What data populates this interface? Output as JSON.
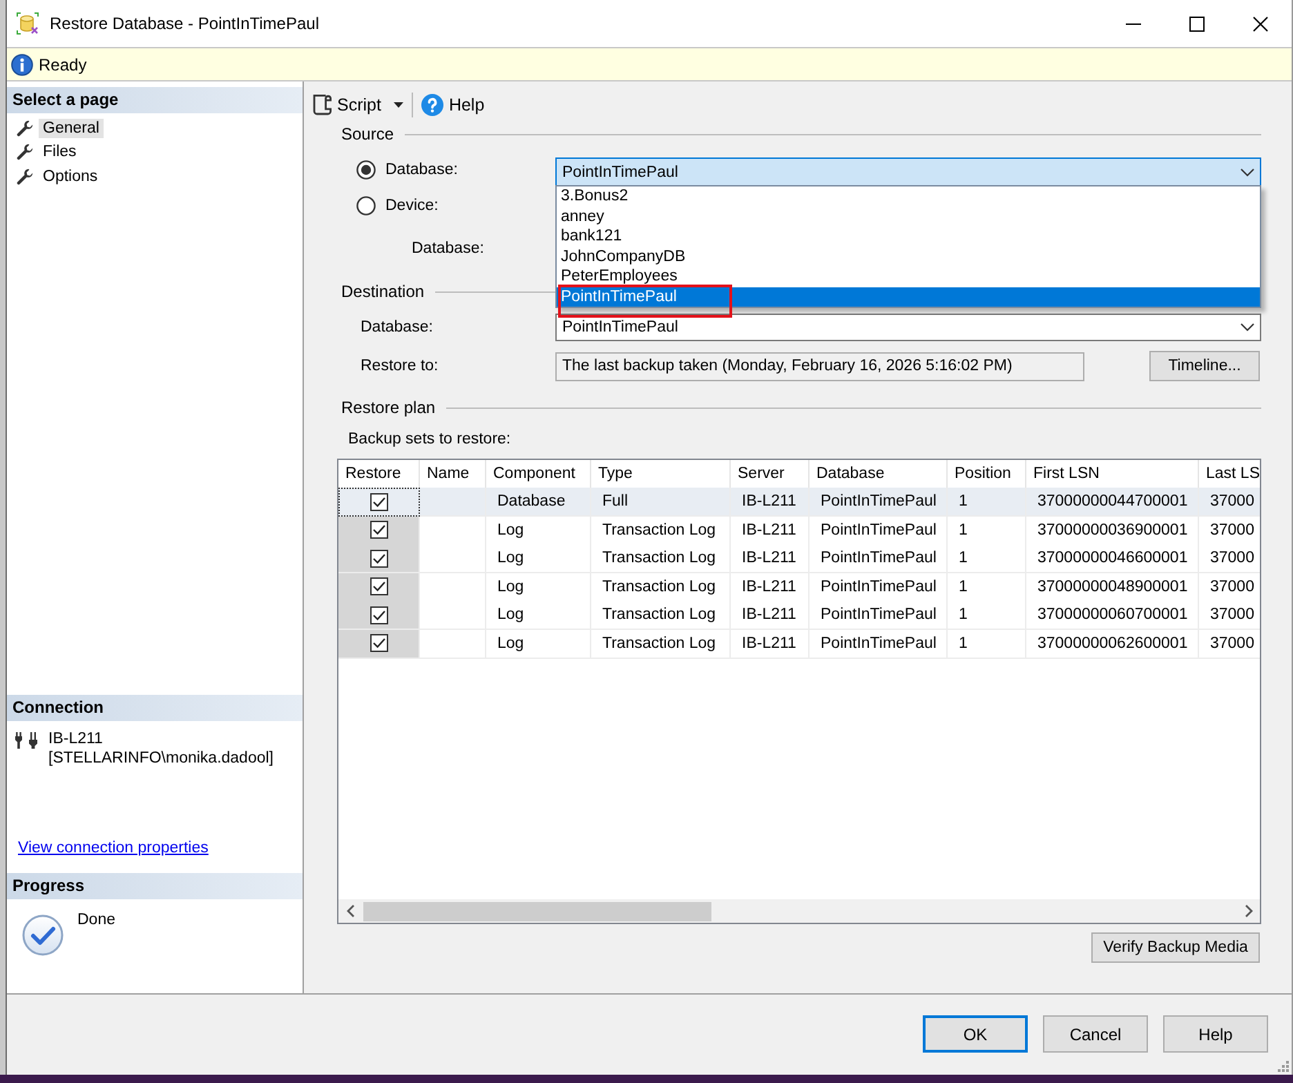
{
  "window": {
    "title": "Restore Database - PointInTimePaul"
  },
  "info_bar": {
    "text": "Ready"
  },
  "sidebar": {
    "title": "Select a page",
    "pages": [
      {
        "label": "General",
        "selected": true
      },
      {
        "label": "Files",
        "selected": false
      },
      {
        "label": "Options",
        "selected": false
      }
    ],
    "connection": {
      "title": "Connection",
      "server": "IB-L211",
      "user": "[STELLARINFO\\monika.dadool]",
      "link": "View connection properties"
    },
    "progress": {
      "title": "Progress",
      "status": "Done"
    }
  },
  "toolbar": {
    "script": "Script",
    "help": "Help"
  },
  "source": {
    "title": "Source",
    "options": [
      {
        "label": "Database:",
        "selected": true
      },
      {
        "label": "Device:",
        "selected": false
      }
    ],
    "database_combo": {
      "value": "PointInTimePaul",
      "expanded": true,
      "items": [
        {
          "label": "3.Bonus2",
          "selected": false,
          "outlined": false
        },
        {
          "label": "anney",
          "selected": false,
          "outlined": false
        },
        {
          "label": "bank121",
          "selected": false,
          "outlined": false
        },
        {
          "label": "JohnCompanyDB",
          "selected": false,
          "outlined": false
        },
        {
          "label": "PeterEmployees",
          "selected": false,
          "outlined": false
        },
        {
          "label": "PointInTimePaul",
          "selected": true,
          "outlined": true
        }
      ]
    },
    "database_label": "Database:"
  },
  "destination": {
    "title": "Destination",
    "database_label": "Database:",
    "database_combo": {
      "value": "PointInTimePaul",
      "expanded": false
    },
    "restore_to_label": "Restore to:",
    "restore_to_value": "The last backup taken (Monday, February 16, 2026 5:16:02 PM)",
    "timeline_button": "Timeline..."
  },
  "restore_plan": {
    "title": "Restore plan",
    "table_label": "Backup sets to restore:",
    "columns": [
      "Restore",
      "Name",
      "Component",
      "Type",
      "Server",
      "Database",
      "Position",
      "First LSN",
      "Last LS"
    ],
    "rows": [
      {
        "selected": true,
        "checked": true,
        "cells": [
          "",
          "",
          "Database",
          "Full",
          "IB-L211",
          "PointInTimePaul",
          "1",
          "37000000044700001",
          "37000"
        ]
      },
      {
        "selected": false,
        "checked": true,
        "cells": [
          "",
          "",
          "Log",
          "Transaction Log",
          "IB-L211",
          "PointInTimePaul",
          "1",
          "37000000036900001",
          "37000"
        ]
      },
      {
        "selected": false,
        "checked": true,
        "cells": [
          "",
          "",
          "Log",
          "Transaction Log",
          "IB-L211",
          "PointInTimePaul",
          "1",
          "37000000046600001",
          "37000"
        ]
      },
      {
        "selected": false,
        "checked": true,
        "cells": [
          "",
          "",
          "Log",
          "Transaction Log",
          "IB-L211",
          "PointInTimePaul",
          "1",
          "37000000048900001",
          "37000"
        ]
      },
      {
        "selected": false,
        "checked": true,
        "cells": [
          "",
          "",
          "Log",
          "Transaction Log",
          "IB-L211",
          "PointInTimePaul",
          "1",
          "37000000060700001",
          "37000"
        ]
      },
      {
        "selected": false,
        "checked": true,
        "cells": [
          "",
          "",
          "Log",
          "Transaction Log",
          "IB-L211",
          "PointInTimePaul",
          "1",
          "37000000062600001",
          "37000"
        ]
      }
    ],
    "verify_button": "Verify Backup Media"
  },
  "buttons": [
    {
      "label": "OK",
      "default": true
    },
    {
      "label": "Cancel",
      "default": false
    },
    {
      "label": "Help",
      "default": false
    }
  ]
}
